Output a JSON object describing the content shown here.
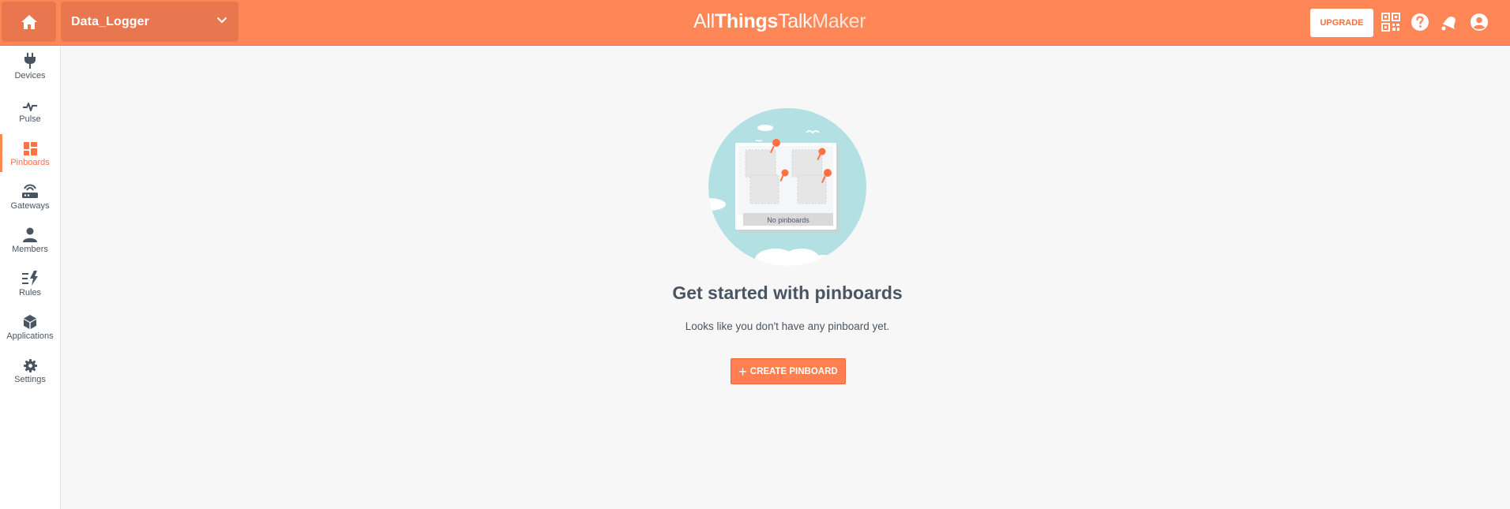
{
  "topbar": {
    "ground_name": "Data_Logger",
    "logo": {
      "all": "All",
      "things": "Things",
      "talk": "Talk",
      "maker": "Maker"
    },
    "upgrade_label": "UPGRADE",
    "icons": [
      "home-icon",
      "chevron-down-icon",
      "qr-code-icon",
      "help-icon",
      "notifications-icon",
      "account-icon"
    ]
  },
  "sidebar": {
    "items": [
      {
        "label": "Devices",
        "icon": "plug-icon"
      },
      {
        "label": "Pulse",
        "icon": "pulse-icon"
      },
      {
        "label": "Pinboards",
        "icon": "pinboards-icon",
        "active": true
      },
      {
        "label": "Gateways",
        "icon": "gateway-icon"
      },
      {
        "label": "Members",
        "icon": "person-icon"
      },
      {
        "label": "Rules",
        "icon": "rules-icon"
      },
      {
        "label": "Applications",
        "icon": "cube-icon"
      },
      {
        "label": "Settings",
        "icon": "gear-icon"
      }
    ]
  },
  "main": {
    "illustration_caption": "No pinboards",
    "title": "Get started with pinboards",
    "text": "Looks like you don't have any pinboard yet.",
    "create_label": "CREATE PINBOARD"
  },
  "colors": {
    "accent": "#ff8657",
    "accent_dark": "#e8774f",
    "sky": "#b3e0e3",
    "text": "#4a5563"
  }
}
